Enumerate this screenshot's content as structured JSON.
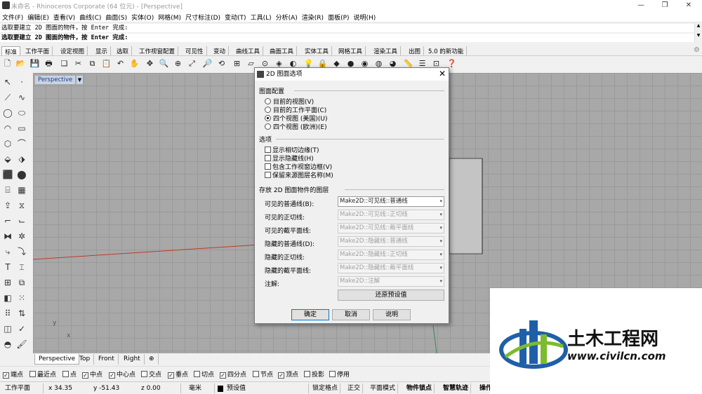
{
  "window": {
    "title": "未命名 - Rhinoceros Corporate (64 位元) - [Perspective]",
    "controls": [
      "—",
      "❐",
      "✕"
    ]
  },
  "menu": [
    "文件(F)",
    "编辑(E)",
    "查看(V)",
    "曲线(C)",
    "曲面(S)",
    "实体(O)",
    "网格(M)",
    "尺寸标注(D)",
    "变动(T)",
    "工具(L)",
    "分析(A)",
    "渲染(R)",
    "面板(P)",
    "说明(H)"
  ],
  "command": {
    "history": "选取要建立 2D 图面的物件，按 Enter 完成:",
    "prompt": "选取要建立 2D 图面的物件，按 Enter 完成:"
  },
  "tabs": [
    "标准",
    "工作平面",
    "设定视图",
    "显示",
    "选取",
    "工作视窗配置",
    "可见性",
    "变动",
    "曲线工具",
    "曲面工具",
    "实体工具",
    "网格工具",
    "渲染工具",
    "出图",
    "5.0 的新功能"
  ],
  "viewport": {
    "label": "Perspective",
    "view_tabs": [
      "Perspective",
      "Top",
      "Front",
      "Right"
    ],
    "add_tab_icon": "add-tab-icon",
    "axis_y": "y",
    "axis_x": "x"
  },
  "osnap": [
    {
      "label": "端点",
      "checked": true
    },
    {
      "label": "最近点",
      "checked": false
    },
    {
      "label": "点",
      "checked": false
    },
    {
      "label": "中点",
      "checked": true
    },
    {
      "label": "中心点",
      "checked": true
    },
    {
      "label": "交点",
      "checked": false
    },
    {
      "label": "垂点",
      "checked": true
    },
    {
      "label": "切点",
      "checked": false
    },
    {
      "label": "四分点",
      "checked": true
    },
    {
      "label": "节点",
      "checked": false
    },
    {
      "label": "顶点",
      "checked": true
    },
    {
      "label": "投影",
      "checked": false
    },
    {
      "label": "停用",
      "checked": false
    }
  ],
  "status": {
    "cplane": "工作平面",
    "x": "x 34.35",
    "y": "y -51.43",
    "z": "z 0.00",
    "unit": "毫米",
    "layer": "预设值",
    "buttons": [
      "锁定格点",
      "正交",
      "平面模式",
      "物件锁点",
      "智慧轨迹",
      "操作"
    ]
  },
  "dialog": {
    "title": "2D 图面选项",
    "layout_group": "图面配置",
    "layout_options": [
      {
        "label": "目前的视图(V)",
        "selected": false
      },
      {
        "label": "目前的工作平面(C)",
        "selected": false
      },
      {
        "label": "四个视图 (美国)(U)",
        "selected": true
      },
      {
        "label": "四个视图 (欧洲)(E)",
        "selected": false
      }
    ],
    "options_group": "选项",
    "options": [
      {
        "label": "显示相切边缘(T)",
        "checked": false
      },
      {
        "label": "显示隐藏线(H)",
        "checked": false
      },
      {
        "label": "包含工作视窗边框(V)",
        "checked": false
      },
      {
        "label": "保留来源图层名称(M)",
        "checked": false
      }
    ],
    "layers_group": "存放 2D 图面物件的图层",
    "layers": [
      {
        "label": "可见的普通线(B):",
        "value": "Make2D::可见线::普通线",
        "enabled": true
      },
      {
        "label": "可见的正切线:",
        "value": "Make2D::可见线::正切线",
        "enabled": false
      },
      {
        "label": "可见的截平面线:",
        "value": "Make2D::可见线::截平面线",
        "enabled": false
      },
      {
        "label": "隐藏的普通线(D):",
        "value": "Make2D::隐藏线::普通线",
        "enabled": false
      },
      {
        "label": "隐藏的正切线:",
        "value": "Make2D::隐藏线::正切线",
        "enabled": false
      },
      {
        "label": "隐藏的截平面线:",
        "value": "Make2D::隐藏线::截平面线",
        "enabled": false
      },
      {
        "label": "注解:",
        "value": "Make2D::注解",
        "enabled": false
      }
    ],
    "restore_label": "还原预设值",
    "ok_label": "确定",
    "cancel_label": "取消",
    "help_label": "说明"
  },
  "watermark": {
    "name": "土木工程网",
    "url": "www.civilcn.com"
  },
  "colors": {
    "accent": "#0078d7",
    "viewport_bg": "#a8a8a8",
    "x_axis": "#c0392b",
    "y_axis": "#2e8b57",
    "logo_blue": "#1f5fa8",
    "logo_green": "#7dbb2e"
  }
}
